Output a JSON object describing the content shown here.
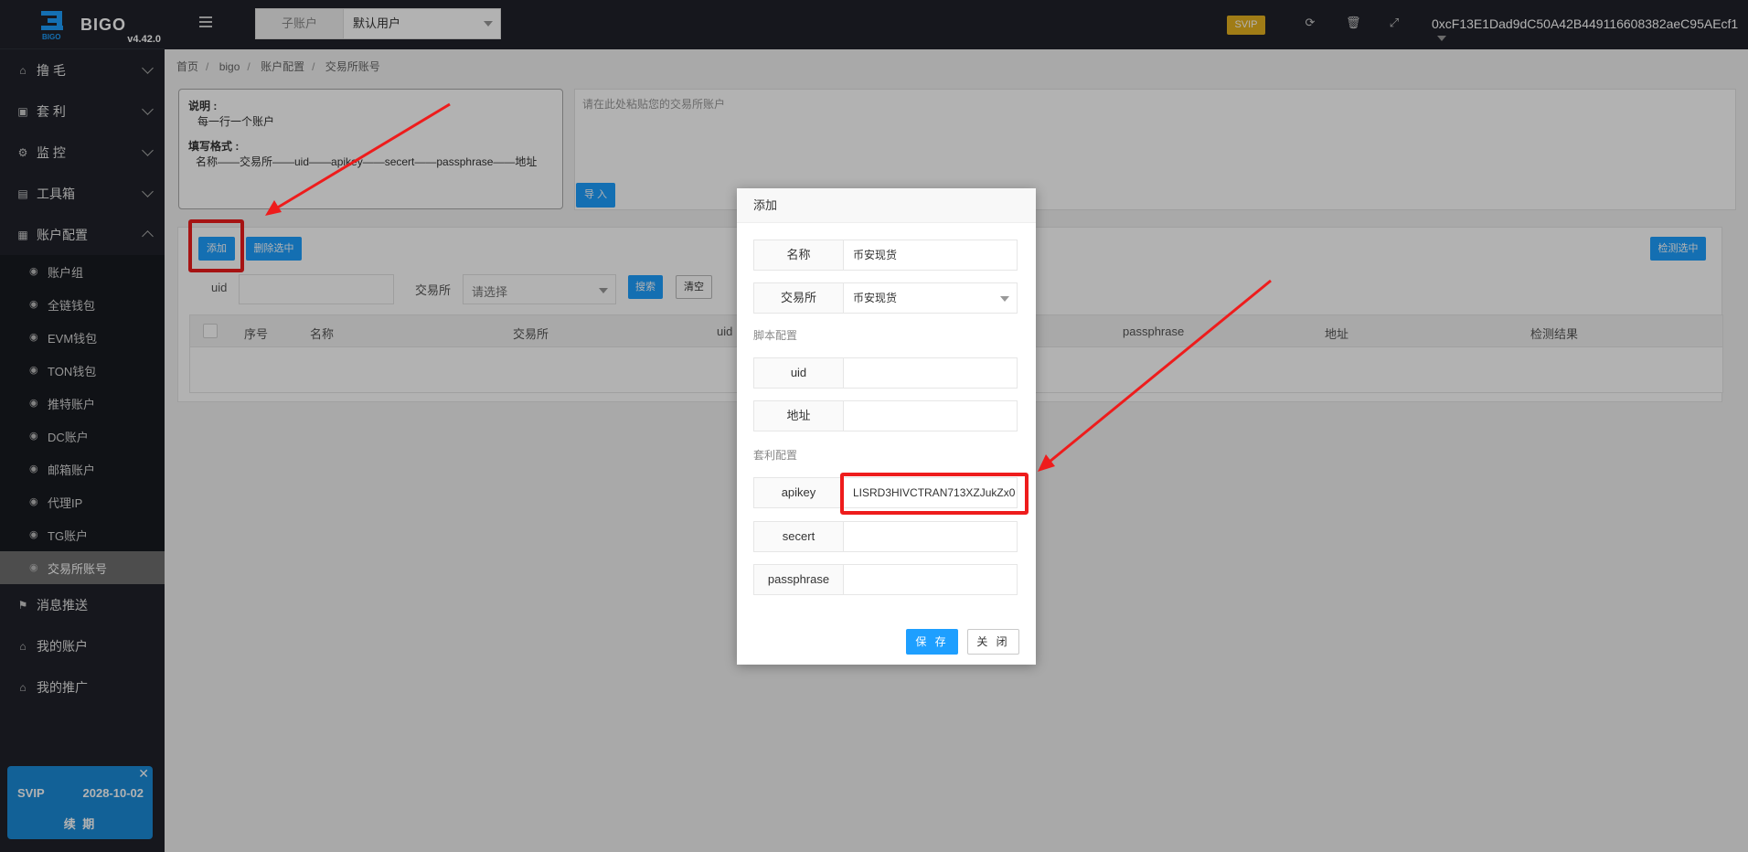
{
  "app": {
    "name": "BIGO",
    "version": "v4.42.0"
  },
  "topbar": {
    "sub_account_label": "子账户",
    "sub_account_value": "默认用户",
    "vip_badge": "SVIP",
    "wallet_address": "0xcF13E1Dad9dC50A42B449116608382aeC95AEcf1"
  },
  "sidebar": {
    "menus": [
      {
        "label": "撸 毛",
        "icon": "home-icon",
        "expanded": false
      },
      {
        "label": "套 利",
        "icon": "window-icon",
        "expanded": false
      },
      {
        "label": "监 控",
        "icon": "gears-icon",
        "expanded": false
      },
      {
        "label": "工具箱",
        "icon": "file-icon",
        "expanded": false
      },
      {
        "label": "账户配置",
        "icon": "calendar-icon",
        "expanded": true
      }
    ],
    "sub_items": [
      {
        "label": "账户组"
      },
      {
        "label": "全链钱包"
      },
      {
        "label": "EVM钱包"
      },
      {
        "label": "TON钱包"
      },
      {
        "label": "推特账户"
      },
      {
        "label": "DC账户"
      },
      {
        "label": "邮箱账户"
      },
      {
        "label": "代理IP"
      },
      {
        "label": "TG账户"
      },
      {
        "label": "交易所账号",
        "active": true
      }
    ],
    "bottom_menus": [
      {
        "label": "消息推送",
        "icon": "flag-icon"
      },
      {
        "label": "我的账户",
        "icon": "home-icon"
      },
      {
        "label": "我的推广",
        "icon": "home-icon"
      }
    ],
    "vip_card": {
      "level": "SVIP",
      "expires": "2028-10-02",
      "renew": "续 期"
    }
  },
  "breadcrumb": [
    "首页",
    "bigo",
    "账户配置",
    "交易所账号"
  ],
  "info": {
    "desc_title": "说明 :",
    "desc_line": "每一行一个账户",
    "format_title": "填写格式 :",
    "format_line": "名称——交易所——uid——apikey——secert——passphrase——地址"
  },
  "paste": {
    "placeholder": "请在此处粘贴您的交易所账户",
    "import_label": "导 入"
  },
  "toolbar": {
    "add_label": "添加",
    "delete_label": "删除选中",
    "check_label": "检测选中"
  },
  "filter": {
    "uid_label": "uid",
    "exchange_label": "交易所",
    "exchange_placeholder": "请选择",
    "search_label": "搜索",
    "clear_label": "清空"
  },
  "table": {
    "columns": [
      "序号",
      "名称",
      "交易所",
      "uid",
      "passphrase",
      "地址",
      "检测结果"
    ]
  },
  "modal": {
    "title": "添加",
    "name_label": "名称",
    "name_value": "币安现货",
    "exchange_label": "交易所",
    "exchange_value": "币安现货",
    "script_section": "脚本配置",
    "uid_label": "uid",
    "address_label": "地址",
    "arb_section": "套利配置",
    "apikey_label": "apikey",
    "apikey_value": "LISRD3HIVCTRAN713XZJukZx0",
    "secret_label": "secert",
    "passphrase_label": "passphrase",
    "save_label": "保 存",
    "close_label": "关 闭"
  },
  "colors": {
    "sidebar_bg": "#20222a",
    "accent_blue": "#1e9fff",
    "highlight_red": "#ee1c1c",
    "vip_gold": "#e6b220"
  }
}
